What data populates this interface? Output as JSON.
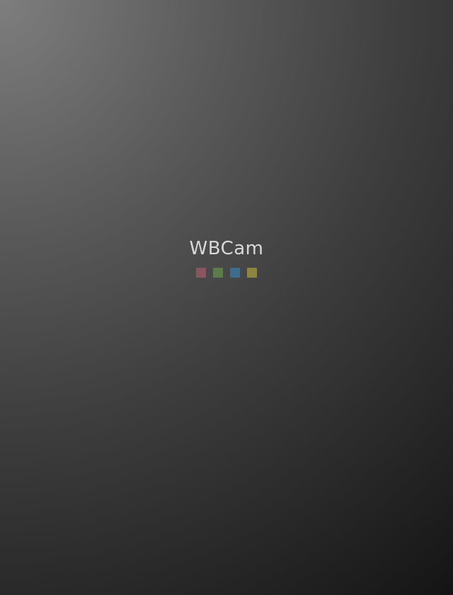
{
  "splash": {
    "app_title": "WBCam",
    "loading_dots": [
      {
        "name": "loading-dot-red",
        "color": "#8a5560"
      },
      {
        "name": "loading-dot-green",
        "color": "#5c7a4b"
      },
      {
        "name": "loading-dot-blue",
        "color": "#3f6b8f"
      },
      {
        "name": "loading-dot-yellow",
        "color": "#8c8540"
      }
    ]
  }
}
